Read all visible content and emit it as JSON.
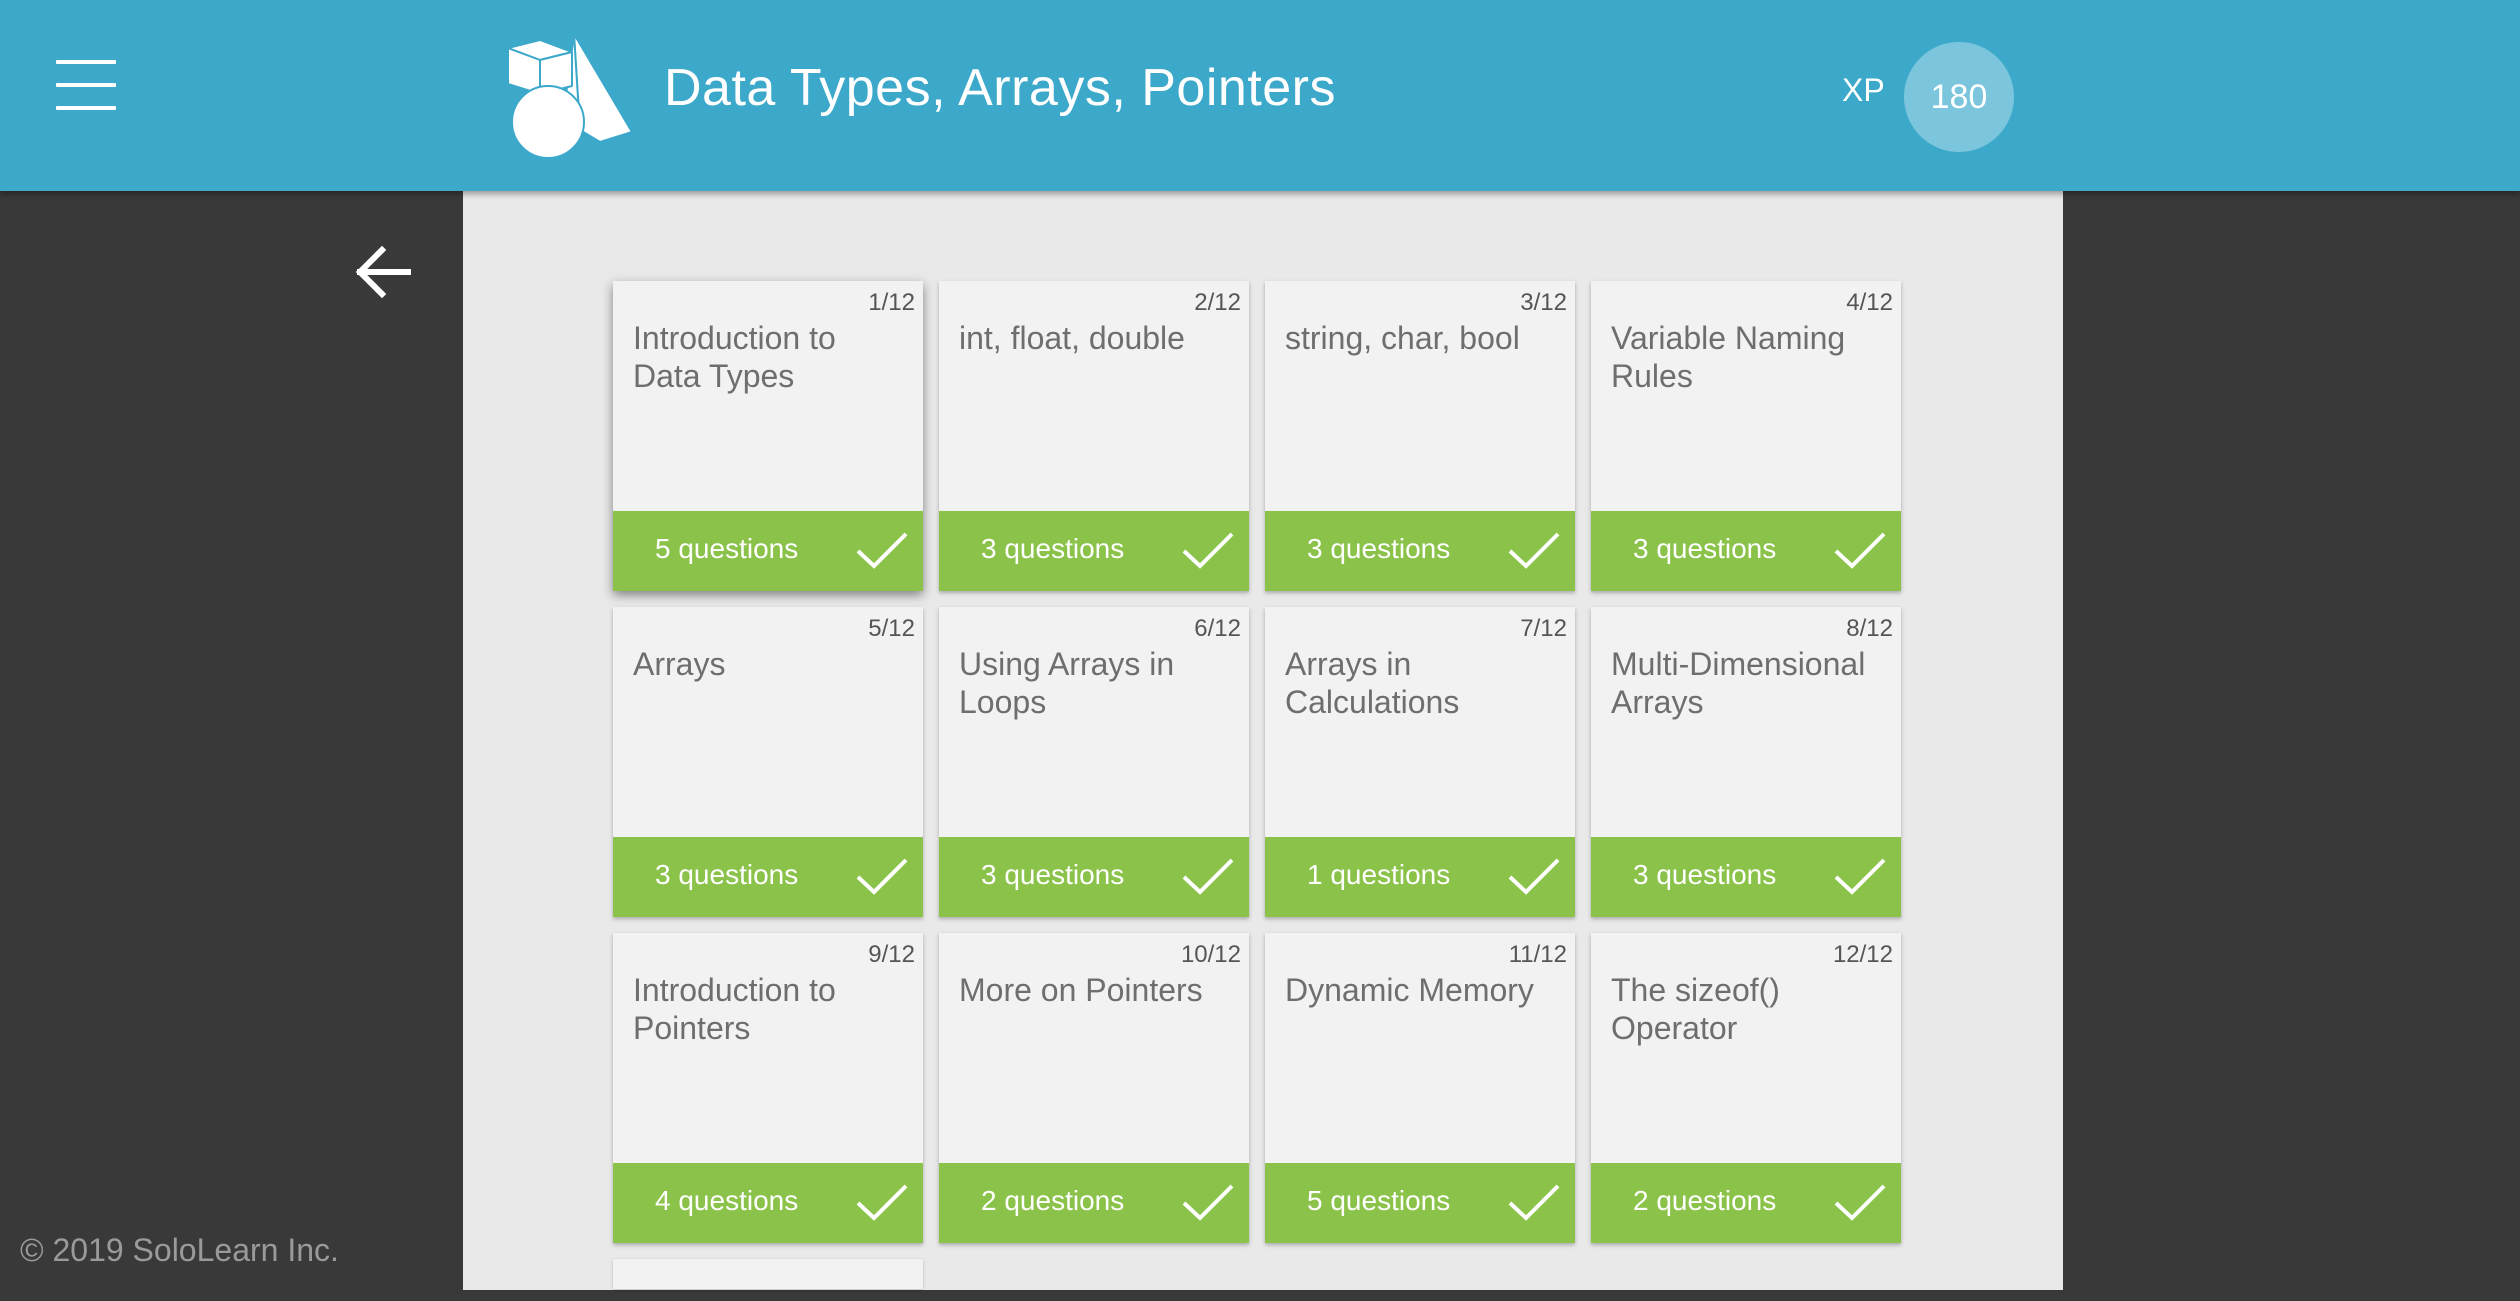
{
  "header": {
    "title": "Data Types, Arrays, Pointers",
    "xp_label": "XP",
    "xp_value": "180",
    "accent_color": "#3ca9cb"
  },
  "icons": {
    "menu": "hamburger-menu-icon",
    "logo": "geometric-shapes-logo",
    "back": "arrow-left-icon",
    "check": "checkmark-icon"
  },
  "footer": {
    "copyright": "© 2019 SoloLearn Inc."
  },
  "lessons": [
    {
      "number": "1/12",
      "title": "Introduction to Data Types",
      "questions": "5 questions",
      "completed": true
    },
    {
      "number": "2/12",
      "title": "int, float, double",
      "questions": "3 questions",
      "completed": true
    },
    {
      "number": "3/12",
      "title": "string, char, bool",
      "questions": "3 questions",
      "completed": true
    },
    {
      "number": "4/12",
      "title": "Variable Naming Rules",
      "questions": "3 questions",
      "completed": true
    },
    {
      "number": "5/12",
      "title": "Arrays",
      "questions": "3 questions",
      "completed": true
    },
    {
      "number": "6/12",
      "title": "Using Arrays in Loops",
      "questions": "3 questions",
      "completed": true
    },
    {
      "number": "7/12",
      "title": "Arrays in Calculations",
      "questions": "1 questions",
      "completed": true
    },
    {
      "number": "8/12",
      "title": "Multi-Dimensional Arrays",
      "questions": "3 questions",
      "completed": true
    },
    {
      "number": "9/12",
      "title": "Introduction to Pointers",
      "questions": "4 questions",
      "completed": true
    },
    {
      "number": "10/12",
      "title": "More on Pointers",
      "questions": "2 questions",
      "completed": true
    },
    {
      "number": "11/12",
      "title": "Dynamic Memory",
      "questions": "5 questions",
      "completed": true
    },
    {
      "number": "12/12",
      "title": "The sizeof() Operator",
      "questions": "2 questions",
      "completed": true
    }
  ],
  "colors": {
    "completed_footer": "#8bc34a",
    "card_bg": "#f2f2f2",
    "sidebar_bg": "#393939",
    "content_bg": "#e9e9e9"
  }
}
